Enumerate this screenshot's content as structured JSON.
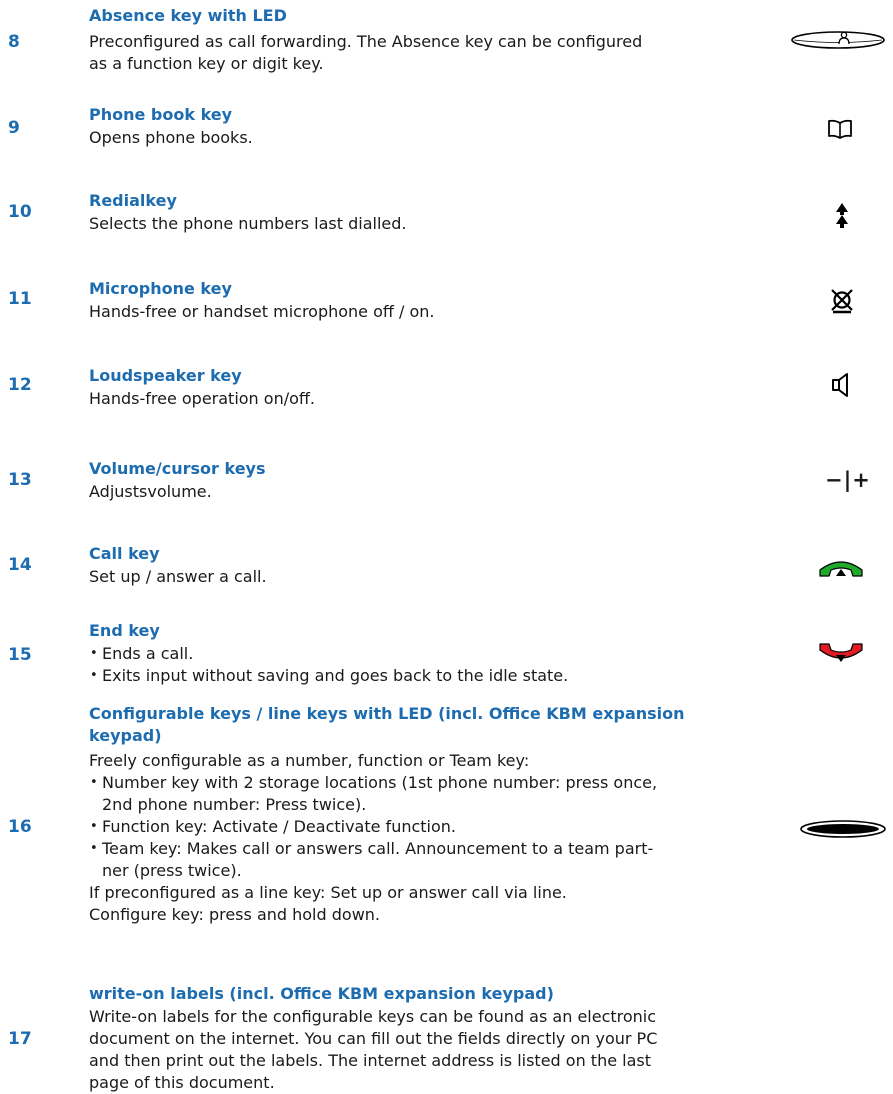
{
  "entries": [
    {
      "number": "8",
      "title": "Absence key  with LED",
      "text": [
        "Preconfigured as call forwarding. The Absence key can be configured",
        "as a function key or digit key."
      ],
      "icon": "absence-key-led-icon"
    },
    {
      "number": "9",
      "title": "Phone book key",
      "text": [
        "Opens phone books."
      ],
      "icon": "phone-book-icon"
    },
    {
      "number": "10",
      "title": "Redialkey",
      "text": [
        "Selects the phone numbers last dialled."
      ],
      "icon": "redial-icon"
    },
    {
      "number": "11",
      "title": "Microphone key",
      "text": [
        "Hands-free or handset microphone off / on."
      ],
      "icon": "microphone-mute-icon"
    },
    {
      "number": "12",
      "title": "Loudspeaker key",
      "text": [
        "Hands-free operation on/off."
      ],
      "icon": "loudspeaker-icon"
    },
    {
      "number": "13",
      "title": "Volume/cursor keys",
      "text": [
        "Adjustsvolume."
      ],
      "icon": "volume-minus-plus-icon",
      "icon_text": "−|+"
    },
    {
      "number": "14",
      "title": "Call key",
      "text": [
        "Set up / answer a call."
      ],
      "icon": "call-handset-green-icon"
    },
    {
      "number": "15",
      "title": "End key",
      "bullets": [
        "Ends a call.",
        "Exits input without saving and goes back to the idle state."
      ],
      "icon": "end-handset-red-icon"
    },
    {
      "number": "16",
      "title": [
        "Configurable keys / line keys with LED (incl. Office KBM expansion",
        "keypad)"
      ],
      "intro": "Freely configurable as a number, function or Team key:",
      "bullets": [
        [
          "Number key with 2 storage locations (1st phone number: press once,",
          "2nd phone number: Press twice)."
        ],
        [
          "Function key:  Activate / Deactivate function."
        ],
        [
          "Team key: Makes call or answers call. Announcement to a team part-",
          "ner (press twice)."
        ]
      ],
      "outro": [
        "If preconfigured as a line key: Set up or answer call via line.",
        "Configure key: press and hold down."
      ],
      "icon": "configurable-key-led-icon"
    },
    {
      "number": "17",
      "title": "write-on labels (incl. Office KBM expansion keypad)",
      "text": [
        "Write-on labels for the configurable keys can be found as an electronic",
        "document on the internet. You can fill out the fields directly on your PC",
        "and then print out the labels. The internet address is listed on the last",
        "page of this document."
      ]
    }
  ],
  "colors": {
    "heading_blue": "#1e6cb0",
    "call_green": "#1faa2a",
    "end_red": "#e01b24",
    "led_green": "#1faa2a",
    "led_red": "#e01b24"
  }
}
